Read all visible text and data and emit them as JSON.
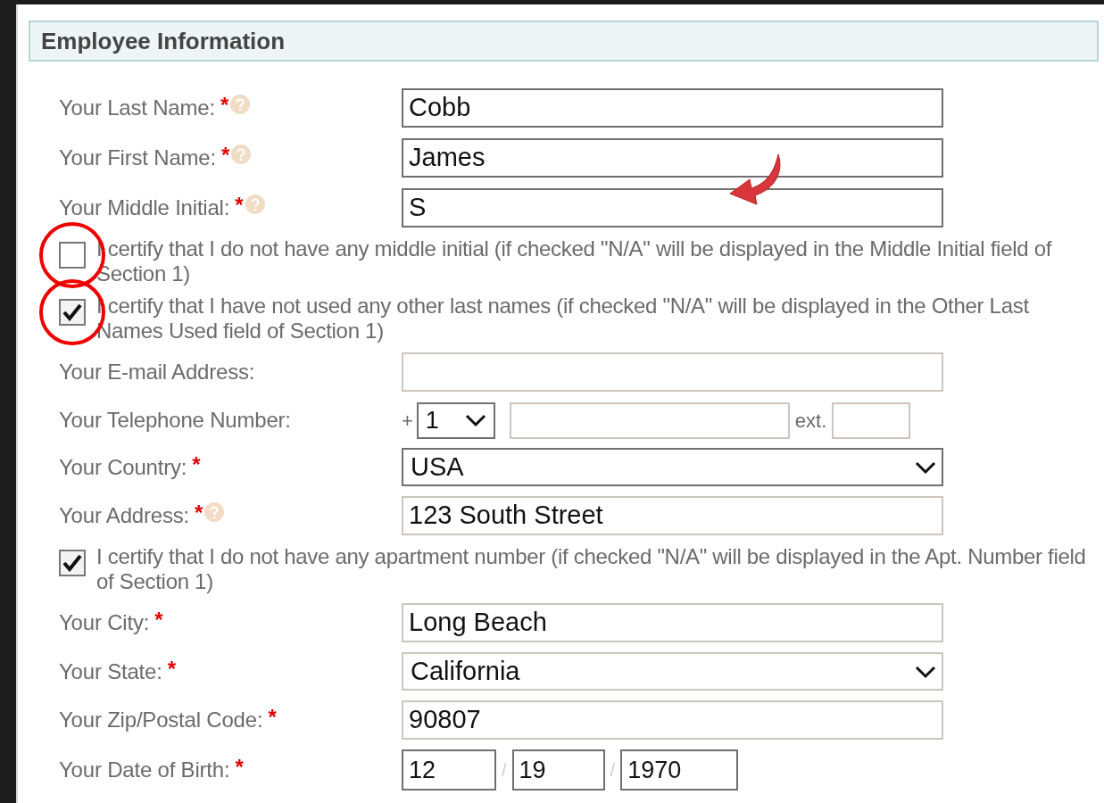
{
  "section": {
    "title": "Employee Information"
  },
  "rows": [
    {
      "kind": "text",
      "label": "Your Last Name:",
      "required_mark": "*",
      "help": true,
      "value": "Cobb",
      "dark_border": true
    },
    {
      "kind": "text",
      "label": "Your First Name:",
      "required_mark": "*",
      "help": true,
      "value": "James",
      "dark_border": true
    },
    {
      "kind": "text",
      "label": "Your Middle Initial:",
      "required_mark": "*",
      "help": true,
      "value": "S",
      "dark_border": true,
      "pointer_arrow": true
    },
    {
      "kind": "checkbox",
      "text": "I certify that I do not have any middle initial (if checked \"N/A\" will be displayed in the Middle Initial field of Section 1)",
      "checked": false,
      "circled": true
    },
    {
      "kind": "checkbox",
      "text": "I certify that I have not used any other last names (if checked \"N/A\" will be displayed in the Other Last Names Used field of Section 1)",
      "checked": true,
      "circled": true
    },
    {
      "kind": "text",
      "label": "Your E-mail Address:",
      "dark_border": false
    },
    {
      "kind": "phone",
      "label": "Your Telephone Number:",
      "prefix": "+",
      "code": "1",
      "ext_label": "ext."
    },
    {
      "kind": "select",
      "label": "Your Country:",
      "required_mark": "*",
      "value": "USA",
      "dark_border": true
    },
    {
      "kind": "text",
      "label": "Your Address:",
      "required_mark": "*",
      "help": true,
      "value": "123 South Street",
      "dark_border": false
    },
    {
      "kind": "checkbox",
      "text": "I certify that I do not have any apartment number (if checked \"N/A\" will be displayed in the Apt. Number field of Section 1)",
      "checked": true,
      "circled": false
    },
    {
      "kind": "text",
      "label": "Your City:",
      "required_mark": "*",
      "value": "Long Beach",
      "dark_border": false
    },
    {
      "kind": "select",
      "label": "Your State:",
      "required_mark": "*",
      "value": "California",
      "dark_border": false
    },
    {
      "kind": "text",
      "label": "Your Zip/Postal Code:",
      "required_mark": "*",
      "value": "90807",
      "dark_border": false
    },
    {
      "kind": "date",
      "label": "Your Date of Birth:",
      "required_mark": "*",
      "separator": "/",
      "month": "12",
      "day": "19",
      "year": "1970"
    }
  ]
}
